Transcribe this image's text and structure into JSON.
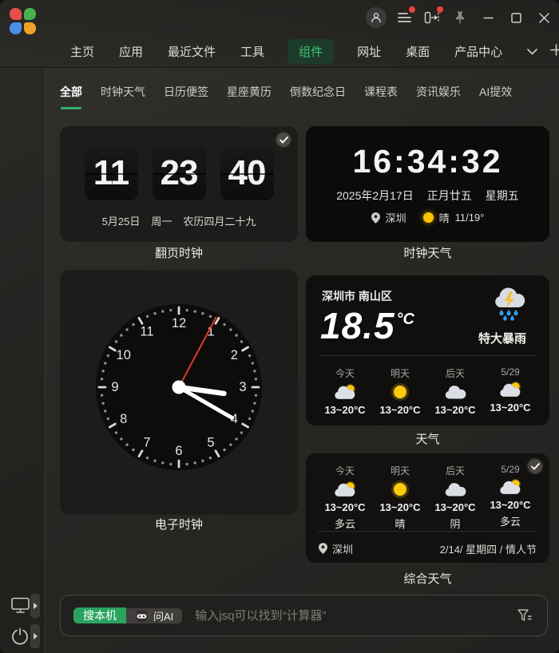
{
  "titlebar": {
    "nav": [
      "主页",
      "应用",
      "最近文件",
      "工具",
      "组件",
      "网址",
      "桌面",
      "产品中心"
    ],
    "window_icons": [
      "user-icon",
      "menu-icon",
      "snap-window-icon",
      "pin-icon",
      "minimize-icon",
      "maximize-icon",
      "close-icon"
    ]
  },
  "subtabs": [
    "全部",
    "时钟天气",
    "日历便签",
    "星座黄历",
    "倒数纪念日",
    "课程表",
    "资讯娱乐",
    "AI提效"
  ],
  "cards": {
    "flip_clock": {
      "label": "翻页时钟",
      "hours": "11",
      "minutes": "23",
      "seconds": "40",
      "date": "5月25日",
      "weekday": "周一",
      "lunar": "农历四月二十九",
      "selected": true
    },
    "clock_weather": {
      "label": "时钟天气",
      "time": "16:34:32",
      "date": "2025年2月17日",
      "lunar_date": "正月廿五",
      "weekday": "星期五",
      "location": "深圳",
      "condition": "晴",
      "temp_range": "11/19°"
    },
    "analog_clock": {
      "label": "电子时钟",
      "numbers": [
        1,
        2,
        3,
        4,
        5,
        6,
        7,
        8,
        9,
        10,
        11,
        12
      ],
      "hour_angle": 98,
      "minute_angle": 120,
      "second_angle": 28
    },
    "weather": {
      "label": "天气",
      "city": "深圳市 南山区",
      "temperature": "18.5",
      "unit": "°C",
      "condition": "特大暴雨",
      "condition_icon": "storm-rain",
      "forecast": [
        {
          "day": "今天",
          "icon": "cloud-sun",
          "temp": "13~20°C"
        },
        {
          "day": "明天",
          "icon": "sun",
          "temp": "13~20°C"
        },
        {
          "day": "后天",
          "icon": "cloud",
          "temp": "13~20°C"
        },
        {
          "day": "5/29",
          "icon": "cloud-sun",
          "temp": "13~20°C"
        }
      ]
    },
    "combined_weather": {
      "label": "综合天气",
      "selected": true,
      "forecast": [
        {
          "day": "今天",
          "icon": "cloud-sun",
          "temp": "13~20°C",
          "condition": "多云"
        },
        {
          "day": "明天",
          "icon": "sun",
          "temp": "13~20°C",
          "condition": "晴"
        },
        {
          "day": "后天",
          "icon": "cloud",
          "temp": "13~20°C",
          "condition": "阴"
        },
        {
          "day": "5/29",
          "icon": "cloud-sun",
          "temp": "13~20°C",
          "condition": "多云"
        }
      ],
      "location": "深圳",
      "date_line": "2/14/ 星期四 / 情人节"
    }
  },
  "searchbar": {
    "local_search_label": "搜本机",
    "ask_ai_label": "问AI",
    "placeholder": "输入jsq可以找到“计算器”",
    "ai_icon": "robot-icon",
    "filter_icon": "filter-icon"
  },
  "sidebar": {
    "icons": [
      "monitor-icon",
      "power-icon"
    ]
  },
  "colors": {
    "accent_green": "#35b169",
    "badge_red": "#e8423c",
    "sun_yellow": "#ffc90b",
    "rain_blue": "#2f9df0",
    "second_hand_red": "#e2392c"
  }
}
